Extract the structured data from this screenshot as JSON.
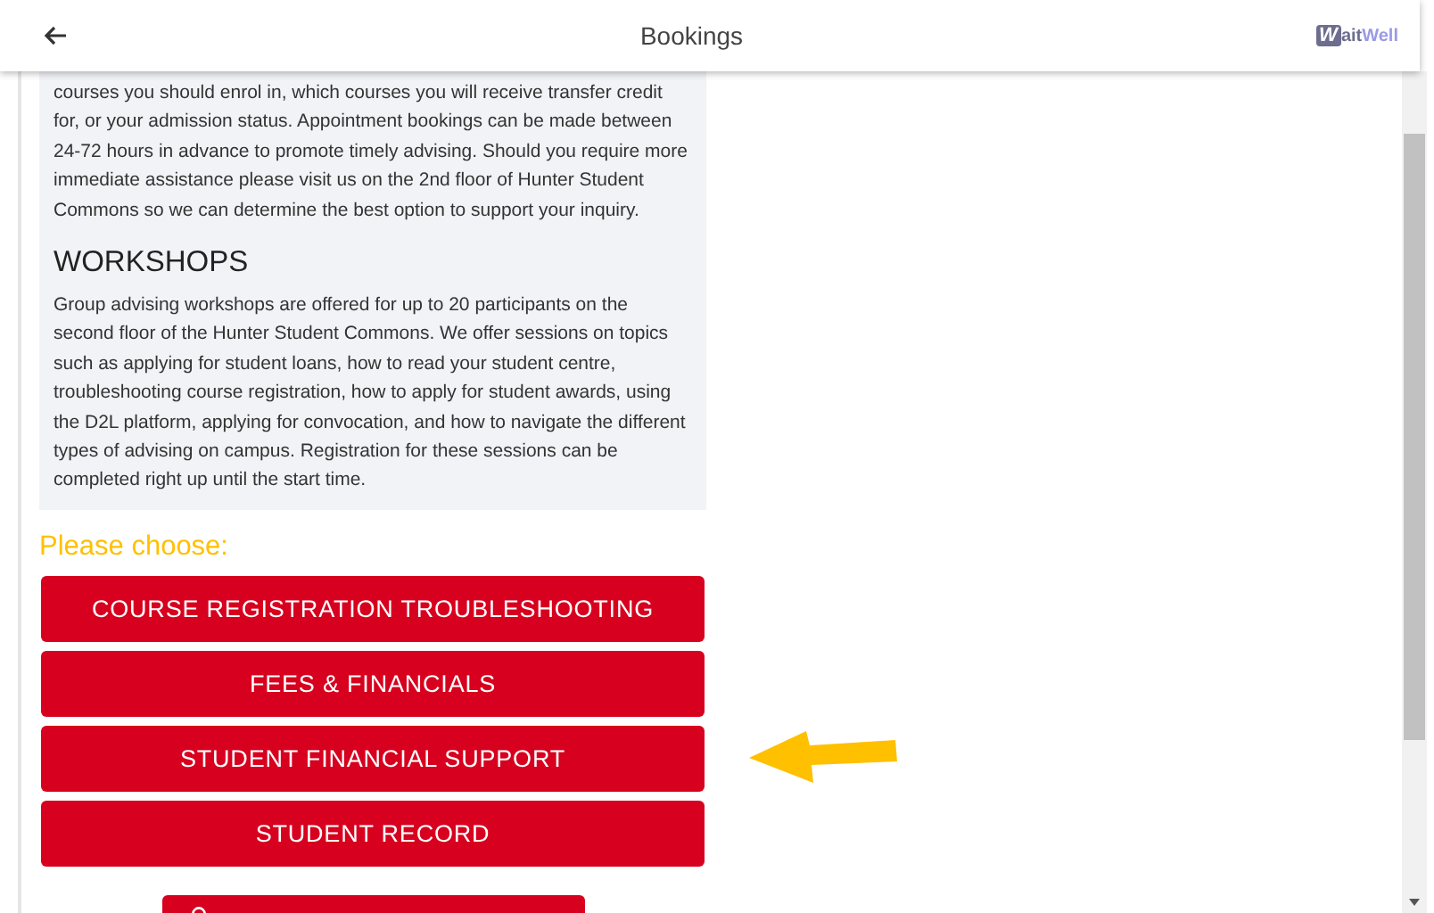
{
  "header": {
    "title": "Bookings",
    "logo": {
      "mark": "W",
      "text_a": "ait",
      "text_b": "Well"
    }
  },
  "info": {
    "intro": "courses you should enrol in, which courses you will receive transfer credit for, or your admission status. Appointment bookings can be made between 24-72 hours in advance to promote timely advising. Should you require more immediate assistance please visit us on the 2nd floor of Hunter Student Commons so we can determine the best option to support your inquiry.",
    "heading": "WORKSHOPS",
    "body": "Group advising workshops are offered for up to 20 participants on the second floor of the Hunter Student Commons. We offer sessions on topics such as applying for student loans, how to read your student centre, troubleshooting course registration, how to apply for student awards, using the D2L platform, applying for convocation, and how to navigate the different types of advising on campus. Registration for these sessions can be completed right up until the start time."
  },
  "prompt": "Please choose:",
  "options": [
    {
      "label": "COURSE REGISTRATION TROUBLESHOOTING"
    },
    {
      "label": "FEES & FINANCIALS"
    },
    {
      "label": "STUDENT FINANCIAL SUPPORT"
    },
    {
      "label": "STUDENT RECORD"
    }
  ]
}
